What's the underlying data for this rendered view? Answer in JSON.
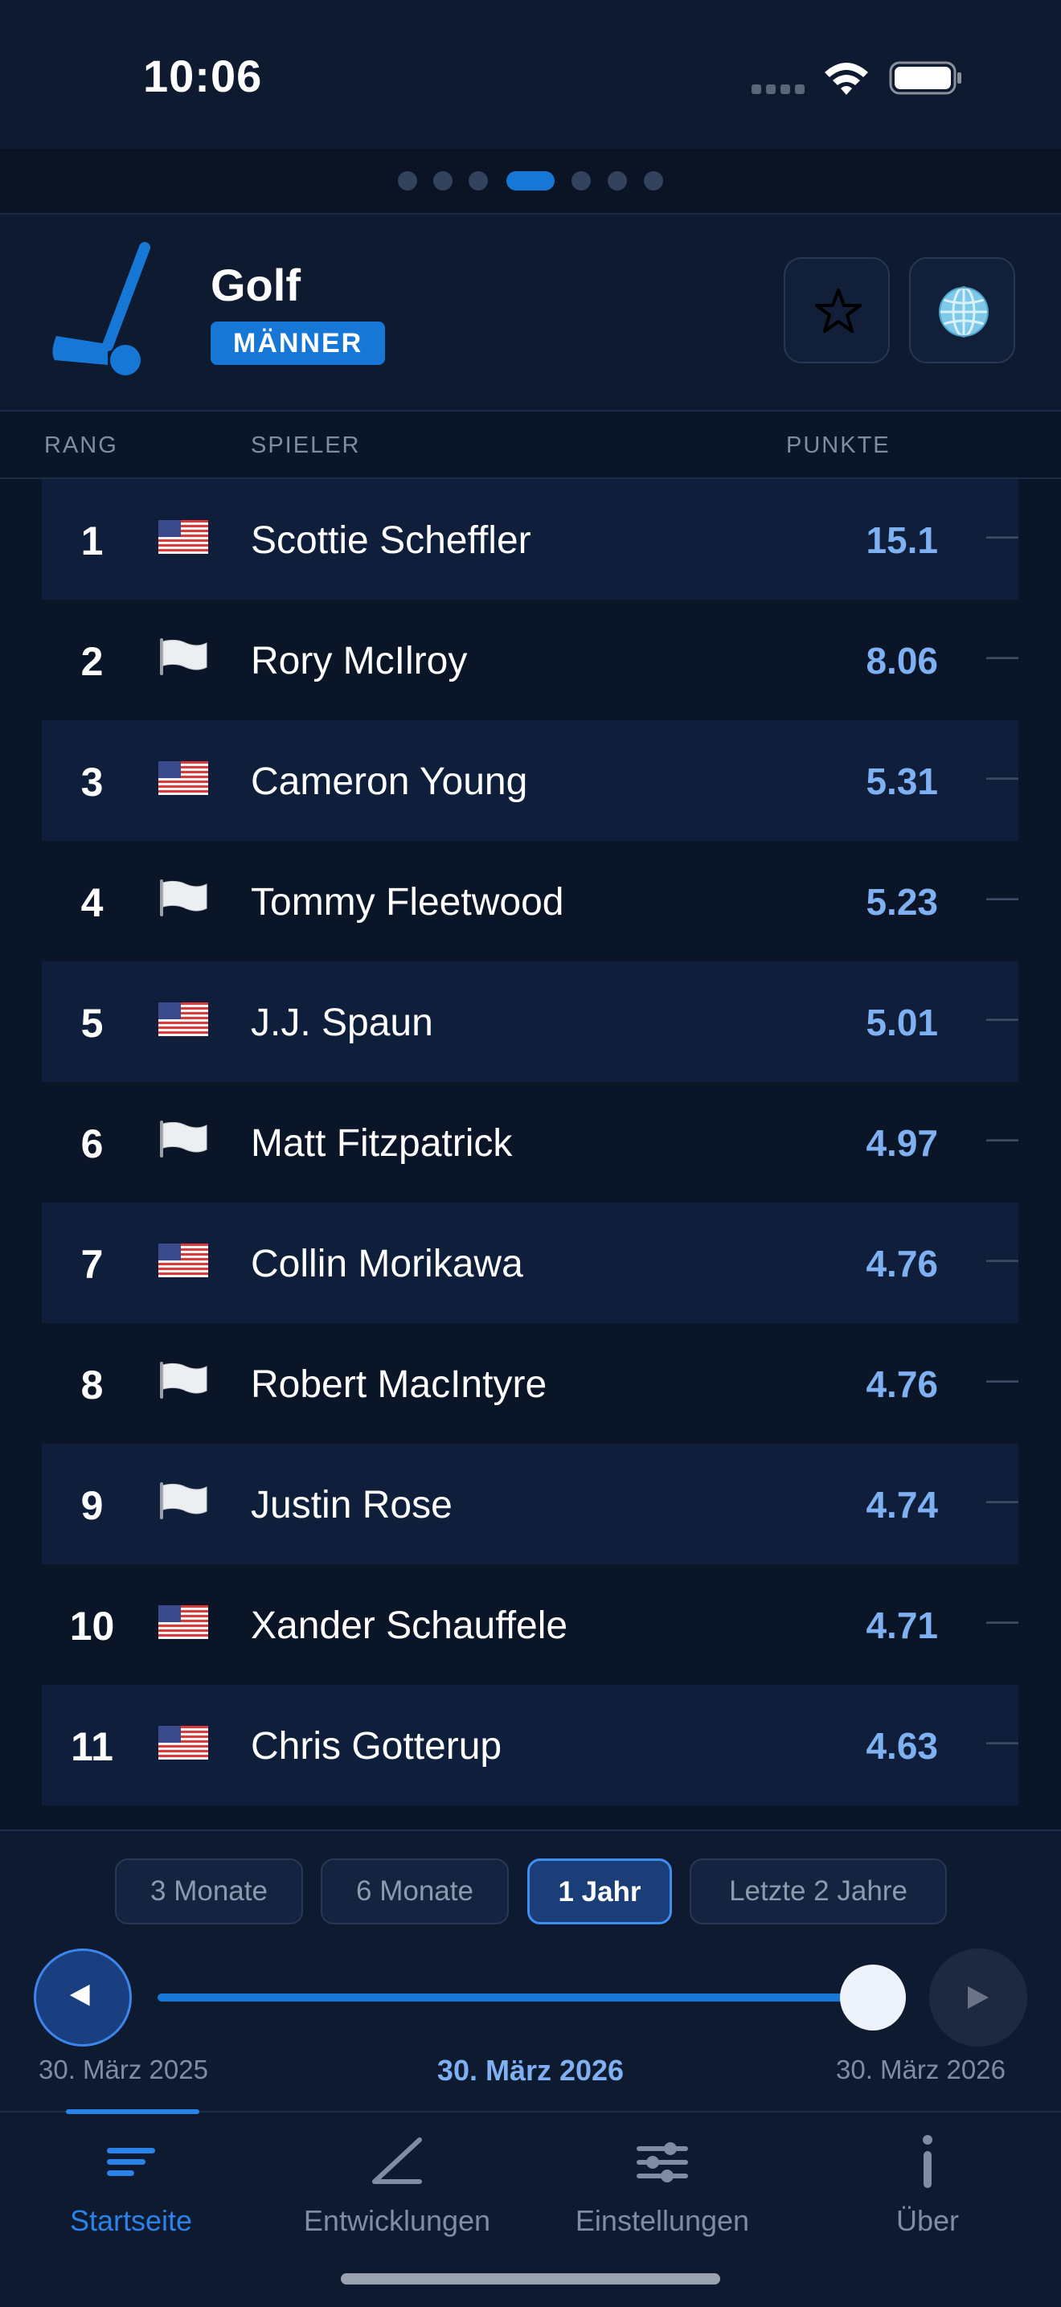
{
  "status": {
    "time": "10:06"
  },
  "header": {
    "title": "Golf",
    "badge": "MÄNNER",
    "favorite_icon": "star-icon",
    "globe_icon": "globe-icon"
  },
  "table": {
    "columns": {
      "rank": "RANG",
      "player": "SPIELER",
      "points": "PUNKTE"
    },
    "rows": [
      {
        "rank": "1",
        "flag": "us",
        "name": "Scottie Scheffler",
        "points": "15.1",
        "trend": "—"
      },
      {
        "rank": "2",
        "flag": "white",
        "name": "Rory McIlroy",
        "points": "8.06",
        "trend": "—"
      },
      {
        "rank": "3",
        "flag": "us",
        "name": "Cameron Young",
        "points": "5.31",
        "trend": "—"
      },
      {
        "rank": "4",
        "flag": "white",
        "name": "Tommy Fleetwood",
        "points": "5.23",
        "trend": "—"
      },
      {
        "rank": "5",
        "flag": "us",
        "name": "J.J. Spaun",
        "points": "5.01",
        "trend": "—"
      },
      {
        "rank": "6",
        "flag": "white",
        "name": "Matt Fitzpatrick",
        "points": "4.97",
        "trend": "—"
      },
      {
        "rank": "7",
        "flag": "us",
        "name": "Collin Morikawa",
        "points": "4.76",
        "trend": "—"
      },
      {
        "rank": "8",
        "flag": "white",
        "name": "Robert MacIntyre",
        "points": "4.76",
        "trend": "—"
      },
      {
        "rank": "9",
        "flag": "white",
        "name": "Justin Rose",
        "points": "4.74",
        "trend": "—"
      },
      {
        "rank": "10",
        "flag": "us",
        "name": "Xander Schauffele",
        "points": "4.71",
        "trend": "—"
      },
      {
        "rank": "11",
        "flag": "us",
        "name": "Chris Gotterup",
        "points": "4.63",
        "trend": "—"
      }
    ]
  },
  "range": {
    "options": [
      "3 Monate",
      "6 Monate",
      "1 Jahr",
      "Letzte 2 Jahre"
    ],
    "selected": "1 Jahr"
  },
  "timeline": {
    "start": "30. März 2025",
    "current": "30. März 2026",
    "end": "30. März 2026",
    "position": 1.0
  },
  "tabs": [
    {
      "label": "Startseite",
      "icon": "list-icon",
      "active": true
    },
    {
      "label": "Entwicklungen",
      "icon": "trend-icon",
      "active": false
    },
    {
      "label": "Einstellungen",
      "icon": "sliders-icon",
      "active": false
    },
    {
      "label": "Über",
      "icon": "info-icon",
      "active": false
    }
  ],
  "colors": {
    "accent": "#1677d6",
    "points": "#7fb0f2",
    "background": "#0b1528"
  }
}
